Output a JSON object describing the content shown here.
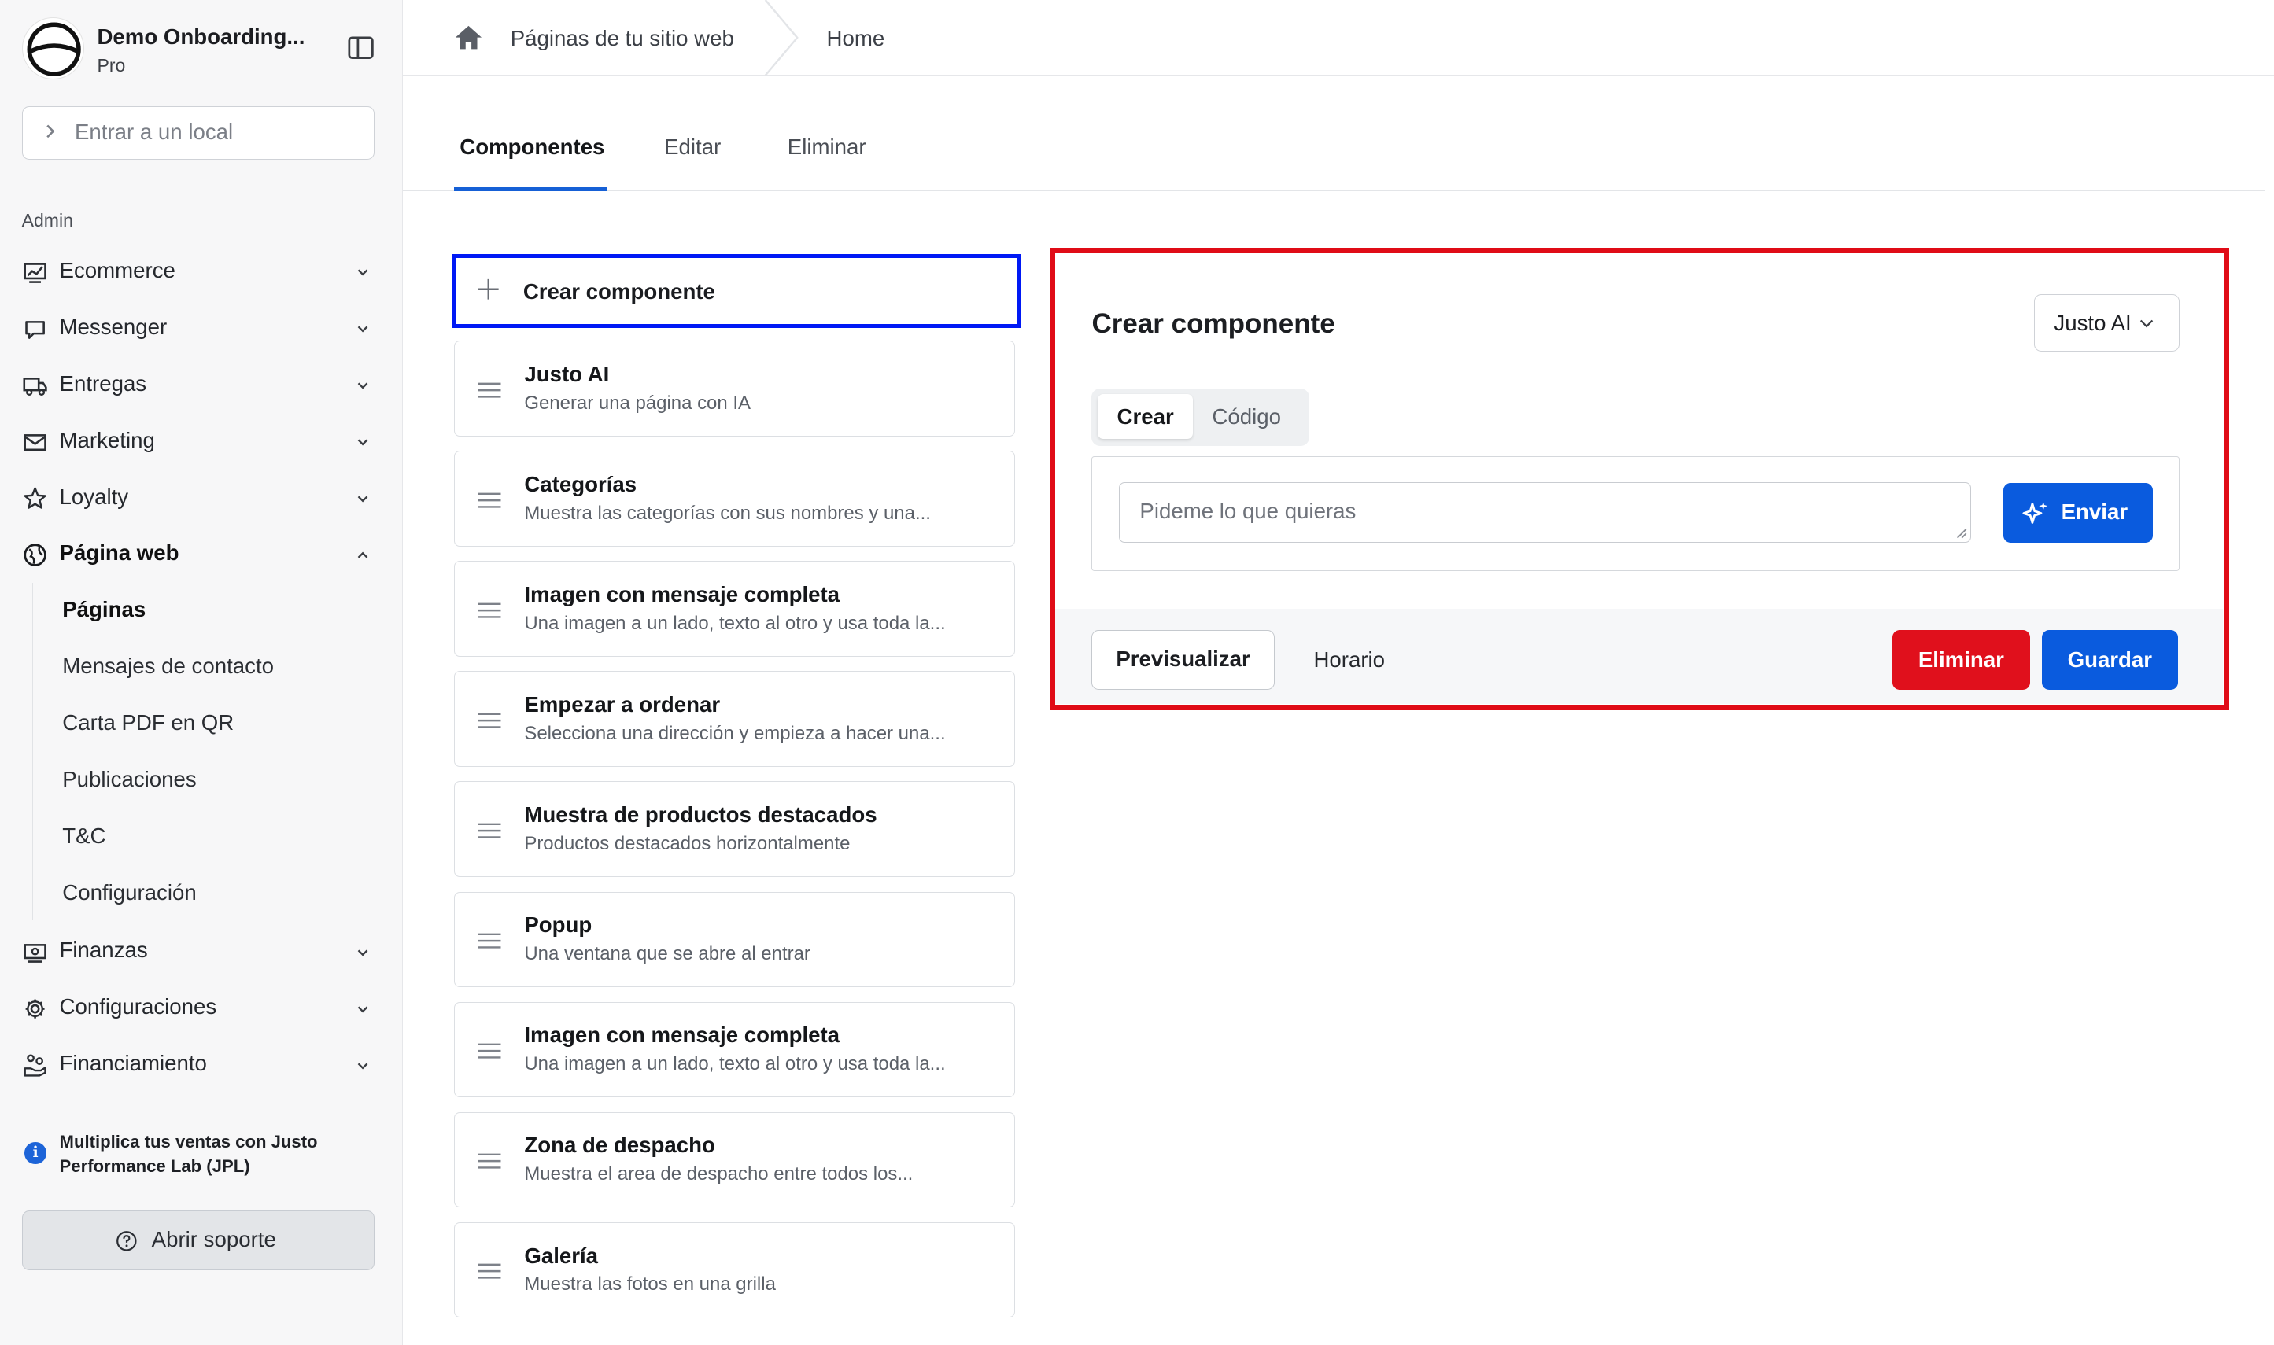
{
  "sidebar": {
    "brand_name": "Demo Onboarding...",
    "plan": "Pro",
    "store_placeholder": "Entrar a un local",
    "section_label": "Admin",
    "nav": [
      {
        "label": "Ecommerce",
        "icon": "chart-icon"
      },
      {
        "label": "Messenger",
        "icon": "chat-bubble-icon"
      },
      {
        "label": "Entregas",
        "icon": "truck-icon"
      },
      {
        "label": "Marketing",
        "icon": "mail-icon"
      },
      {
        "label": "Loyalty",
        "icon": "star-icon"
      },
      {
        "label": "Página web",
        "icon": "globe-icon",
        "expanded": true
      }
    ],
    "subnav": [
      {
        "label": "Páginas",
        "active": true
      },
      {
        "label": "Mensajes de contacto"
      },
      {
        "label": "Carta PDF en QR"
      },
      {
        "label": "Publicaciones"
      },
      {
        "label": "T&C"
      },
      {
        "label": "Configuración"
      }
    ],
    "nav_bottom": [
      {
        "label": "Finanzas",
        "icon": "money-icon"
      },
      {
        "label": "Configuraciones",
        "icon": "gear-icon"
      },
      {
        "label": "Financiamiento",
        "icon": "hand-coins-icon"
      }
    ],
    "promo": "Multiplica tus ventas con Justo Performance Lab (JPL)",
    "support_label": "Abrir soporte"
  },
  "breadcrumb": {
    "parent": "Páginas de tu sitio web",
    "current": "Home"
  },
  "tabs": [
    "Componentes",
    "Editar",
    "Eliminar"
  ],
  "components": {
    "create_label": "Crear componente",
    "items": [
      {
        "title": "Justo AI",
        "desc": "Generar una página con IA"
      },
      {
        "title": "Categorías",
        "desc": "Muestra las categorías con sus nombres y una..."
      },
      {
        "title": "Imagen con mensaje completa",
        "desc": "Una imagen a un lado, texto al otro y usa toda la..."
      },
      {
        "title": "Empezar a ordenar",
        "desc": "Selecciona una dirección y empieza a hacer una..."
      },
      {
        "title": "Muestra de productos destacados",
        "desc": "Productos destacados horizontalmente"
      },
      {
        "title": "Popup",
        "desc": "Una ventana que se abre al entrar"
      },
      {
        "title": "Imagen con mensaje completa",
        "desc": "Una imagen a un lado, texto al otro y usa toda la..."
      },
      {
        "title": "Zona de despacho",
        "desc": "Muestra el area de despacho entre todos los..."
      },
      {
        "title": "Galería",
        "desc": "Muestra las fotos en una grilla"
      }
    ]
  },
  "editor": {
    "title": "Crear componente",
    "type_select": "Justo AI",
    "seg_create": "Crear",
    "seg_code": "Código",
    "prompt_placeholder": "Pideme lo que quieras",
    "send_label": "Enviar",
    "preview_label": "Previsualizar",
    "schedule_label": "Horario",
    "delete_label": "Eliminar",
    "save_label": "Guardar"
  },
  "colors": {
    "primary": "#0a5bde",
    "danger": "#e0101c",
    "highlight_blue": "#0019f5",
    "highlight_red": "#e00c17"
  }
}
